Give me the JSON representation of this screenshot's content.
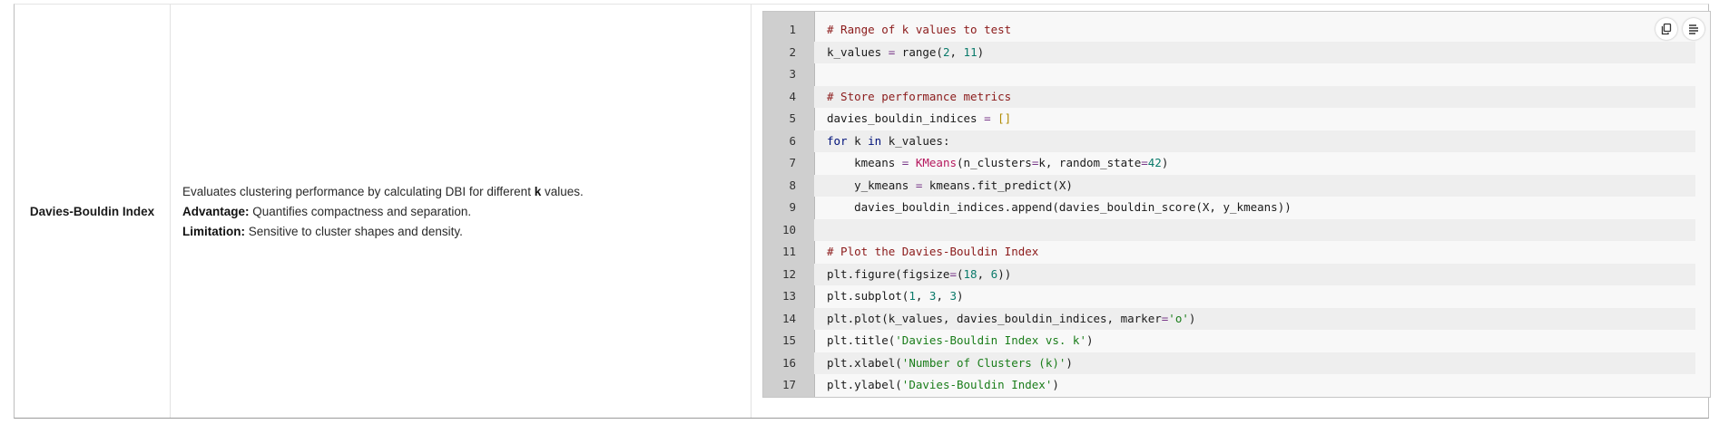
{
  "table_row": {
    "metric_name": "Davies-Bouldin Index",
    "description": {
      "line1_prefix": "Evaluates clustering performance by calculating DBI for different ",
      "line1_bold": "k",
      "line1_suffix": " values.",
      "advantage_label": "Advantage:",
      "advantage_text": " Quantifies compactness and separation.",
      "limitation_label": "Limitation:",
      "limitation_text": " Sensitive to cluster shapes and density."
    }
  },
  "code_block": {
    "toolbar": {
      "copy_icon": "copy-icon",
      "wrap_icon": "wrap-lines-icon"
    },
    "lines": [
      {
        "n": "1",
        "tokens": [
          [
            "comment",
            "# Range of k values to test"
          ]
        ]
      },
      {
        "n": "2",
        "tokens": [
          [
            "plain",
            "k_values "
          ],
          [
            "op",
            "="
          ],
          [
            "plain",
            " range("
          ],
          [
            "num",
            "2"
          ],
          [
            "plain",
            ", "
          ],
          [
            "num",
            "11"
          ],
          [
            "plain",
            ")"
          ]
        ]
      },
      {
        "n": "3",
        "tokens": []
      },
      {
        "n": "4",
        "tokens": [
          [
            "comment",
            "# Store performance metrics"
          ]
        ]
      },
      {
        "n": "5",
        "tokens": [
          [
            "plain",
            "davies_bouldin_indices "
          ],
          [
            "op",
            "="
          ],
          [
            "plain",
            " "
          ],
          [
            "bracket",
            "[]"
          ]
        ]
      },
      {
        "n": "6",
        "tokens": [
          [
            "kw",
            "for"
          ],
          [
            "plain",
            " k "
          ],
          [
            "kw",
            "in"
          ],
          [
            "plain",
            " k_values:"
          ]
        ]
      },
      {
        "n": "7",
        "tokens": [
          [
            "plain",
            "    kmeans "
          ],
          [
            "op",
            "="
          ],
          [
            "plain",
            " "
          ],
          [
            "cls",
            "KMeans"
          ],
          [
            "plain",
            "(n_clusters"
          ],
          [
            "op",
            "="
          ],
          [
            "plain",
            "k, random_state"
          ],
          [
            "op",
            "="
          ],
          [
            "num",
            "42"
          ],
          [
            "plain",
            ")"
          ]
        ]
      },
      {
        "n": "8",
        "tokens": [
          [
            "plain",
            "    y_kmeans "
          ],
          [
            "op",
            "="
          ],
          [
            "plain",
            " kmeans.fit_predict(X)"
          ]
        ]
      },
      {
        "n": "9",
        "tokens": [
          [
            "plain",
            "    davies_bouldin_indices.append(davies_bouldin_score(X, y_kmeans))"
          ]
        ]
      },
      {
        "n": "10",
        "tokens": []
      },
      {
        "n": "11",
        "tokens": [
          [
            "comment",
            "# Plot the Davies-Bouldin Index"
          ]
        ]
      },
      {
        "n": "12",
        "tokens": [
          [
            "plain",
            "plt.figure(figsize"
          ],
          [
            "op",
            "="
          ],
          [
            "plain",
            "("
          ],
          [
            "num",
            "18"
          ],
          [
            "plain",
            ", "
          ],
          [
            "num",
            "6"
          ],
          [
            "plain",
            "))"
          ]
        ]
      },
      {
        "n": "13",
        "tokens": [
          [
            "plain",
            "plt.subplot("
          ],
          [
            "num",
            "1"
          ],
          [
            "plain",
            ", "
          ],
          [
            "num",
            "3"
          ],
          [
            "plain",
            ", "
          ],
          [
            "num",
            "3"
          ],
          [
            "plain",
            ")"
          ]
        ]
      },
      {
        "n": "14",
        "tokens": [
          [
            "plain",
            "plt.plot(k_values, davies_bouldin_indices, marker"
          ],
          [
            "op",
            "="
          ],
          [
            "str",
            "'o'"
          ],
          [
            "plain",
            ")"
          ]
        ]
      },
      {
        "n": "15",
        "tokens": [
          [
            "plain",
            "plt.title("
          ],
          [
            "str",
            "'Davies-Bouldin Index vs. k'"
          ],
          [
            "plain",
            ")"
          ]
        ]
      },
      {
        "n": "16",
        "tokens": [
          [
            "plain",
            "plt.xlabel("
          ],
          [
            "str",
            "'Number of Clusters (k)'"
          ],
          [
            "plain",
            ")"
          ]
        ]
      },
      {
        "n": "17",
        "tokens": [
          [
            "plain",
            "plt.ylabel("
          ],
          [
            "str",
            "'Davies-Bouldin Index'"
          ],
          [
            "plain",
            ")"
          ]
        ]
      }
    ]
  },
  "colors": {
    "comment": "#8b1a1a",
    "keyword": "#00127a",
    "number": "#0a7a6a",
    "string": "#1a7d1a",
    "gutter": "#cfcfcf",
    "code_bg": "#f8f8f8"
  }
}
